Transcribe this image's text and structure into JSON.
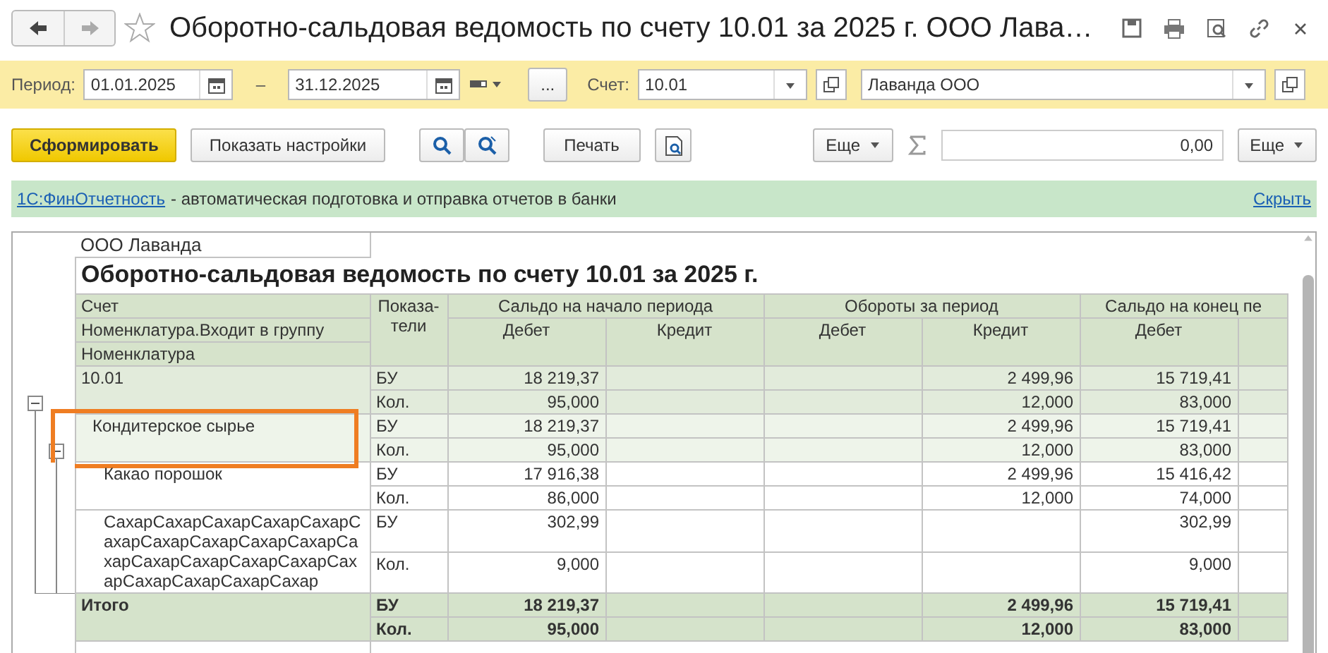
{
  "window": {
    "title": "Оборотно-сальдовая ведомость по счету 10.01 за 2025 г. ООО Лава…",
    "favorite": false
  },
  "filters": {
    "period_label": "Период:",
    "period_from": "01.01.2025",
    "dash": "–",
    "period_to": "31.12.2025",
    "choose_button": "...",
    "account_label": "Счет:",
    "account": "10.01",
    "organization": "Лаванда ООО"
  },
  "toolbar": {
    "generate": "Сформировать",
    "settings": "Показать настройки",
    "print": "Печать",
    "more": "Еще",
    "sum": "0,00",
    "more_right": "Еще"
  },
  "banner": {
    "link": "1С:ФинОтчетность",
    "text": "- автоматическая подготовка и отправка отчетов в банки",
    "hide": "Скрыть"
  },
  "report": {
    "company": "ООО Лаванда",
    "title": "Оборотно-сальдовая ведомость по счету 10.01 за 2025 г.",
    "row_headers": [
      "Счет",
      "Номенклатура.Входит в группу",
      "Номенклатура"
    ],
    "indicator_header": "Показа-\nтели",
    "groups": [
      {
        "title": "Сальдо на начало периода",
        "columns": [
          "Дебет",
          "Кредит"
        ]
      },
      {
        "title": "Обороты за период",
        "columns": [
          "Дебет",
          "Кредит"
        ]
      },
      {
        "title": "Сальдо на конец пе",
        "columns": [
          "Дебет"
        ]
      }
    ],
    "rows": [
      {
        "kind": "account",
        "name": "10.01",
        "expanded": true,
        "lines": [
          {
            "indicator": "БУ",
            "debit_start": "18 219,37",
            "credit_turnover": "2 499,96",
            "debit_end": "15 719,41"
          },
          {
            "indicator": "Кол.",
            "debit_start": "95,000",
            "credit_turnover": "12,000",
            "debit_end": "83,000"
          }
        ],
        "children": [
          {
            "kind": "group",
            "name": "Кондитерское сырье",
            "expanded": true,
            "highlighted": true,
            "lines": [
              {
                "indicator": "БУ",
                "debit_start": "18 219,37",
                "credit_turnover": "2 499,96",
                "debit_end": "15 719,41"
              },
              {
                "indicator": "Кол.",
                "debit_start": "95,000",
                "credit_turnover": "12,000",
                "debit_end": "83,000"
              }
            ],
            "children": [
              {
                "kind": "item",
                "name": "Какао порошок",
                "lines": [
                  {
                    "indicator": "БУ",
                    "debit_start": "17 916,38",
                    "credit_turnover": "2 499,96",
                    "debit_end": "15 416,42"
                  },
                  {
                    "indicator": "Кол.",
                    "debit_start": "86,000",
                    "credit_turnover": "12,000",
                    "debit_end": "74,000"
                  }
                ]
              },
              {
                "kind": "item",
                "name": "СахарСахарСахарСахарСахарСахарСахарСахарСахарСахарСахарСахарСахарСахарСахарСахарСахарСахарСахарСахар",
                "lines": [
                  {
                    "indicator": "БУ",
                    "debit_start": "302,99",
                    "debit_end": "302,99"
                  },
                  {
                    "indicator": "Кол.",
                    "debit_start": "9,000",
                    "debit_end": "9,000"
                  }
                ]
              }
            ]
          }
        ]
      },
      {
        "kind": "total",
        "name": "Итого",
        "lines": [
          {
            "indicator": "БУ",
            "debit_start": "18 219,37",
            "credit_turnover": "2 499,96",
            "debit_end": "15 719,41"
          },
          {
            "indicator": "Кол.",
            "debit_start": "95,000",
            "credit_turnover": "12,000",
            "debit_end": "83,000"
          }
        ]
      }
    ]
  }
}
